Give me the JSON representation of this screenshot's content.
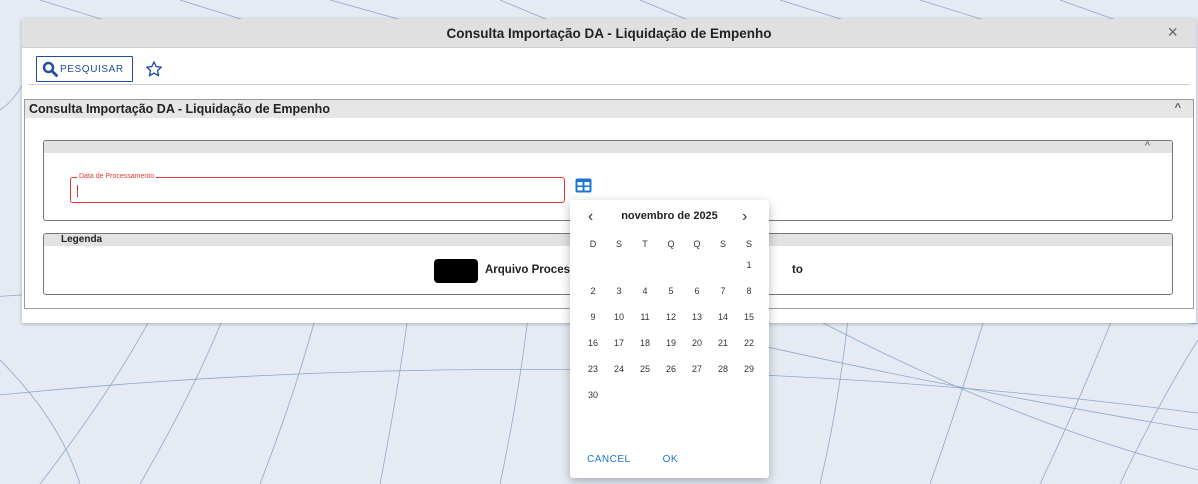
{
  "window": {
    "title": "Consulta Importação DA - Liquidação de Empenho",
    "close_glyph": "×"
  },
  "toolbar": {
    "search_label": "PESQUISAR",
    "search_icon": "magnifier-icon",
    "favorite_icon": "star-outline-icon",
    "accent_color": "#1f4e9e"
  },
  "panel": {
    "title": "Consulta Importação DA - Liquidação de Empenho",
    "collapse_glyph": "^"
  },
  "filter": {
    "collapse_glyph": "^",
    "date_label": "Data de Processamento",
    "date_value": "",
    "calendar_icon": "calendar-grid-icon",
    "error_color": "#e53935"
  },
  "legend": {
    "title": "Legenda",
    "items": [
      {
        "label": "Arquivo Processa",
        "color": "#000000"
      },
      {
        "label": "to"
      }
    ]
  },
  "datepicker": {
    "month_label": "novembro de 2025",
    "prev_glyph": "‹",
    "next_glyph": "›",
    "weekdays": [
      "D",
      "S",
      "T",
      "Q",
      "Q",
      "S",
      "S"
    ],
    "weeks": [
      [
        "",
        "",
        "",
        "",
        "",
        "",
        "1"
      ],
      [
        "2",
        "3",
        "4",
        "5",
        "6",
        "7",
        "8"
      ],
      [
        "9",
        "10",
        "11",
        "12",
        "13",
        "14",
        "15"
      ],
      [
        "16",
        "17",
        "18",
        "19",
        "20",
        "21",
        "22"
      ],
      [
        "23",
        "24",
        "25",
        "26",
        "27",
        "28",
        "29"
      ],
      [
        "30",
        "",
        "",
        "",
        "",
        "",
        ""
      ]
    ],
    "cancel_label": "CANCEL",
    "ok_label": "OK"
  }
}
